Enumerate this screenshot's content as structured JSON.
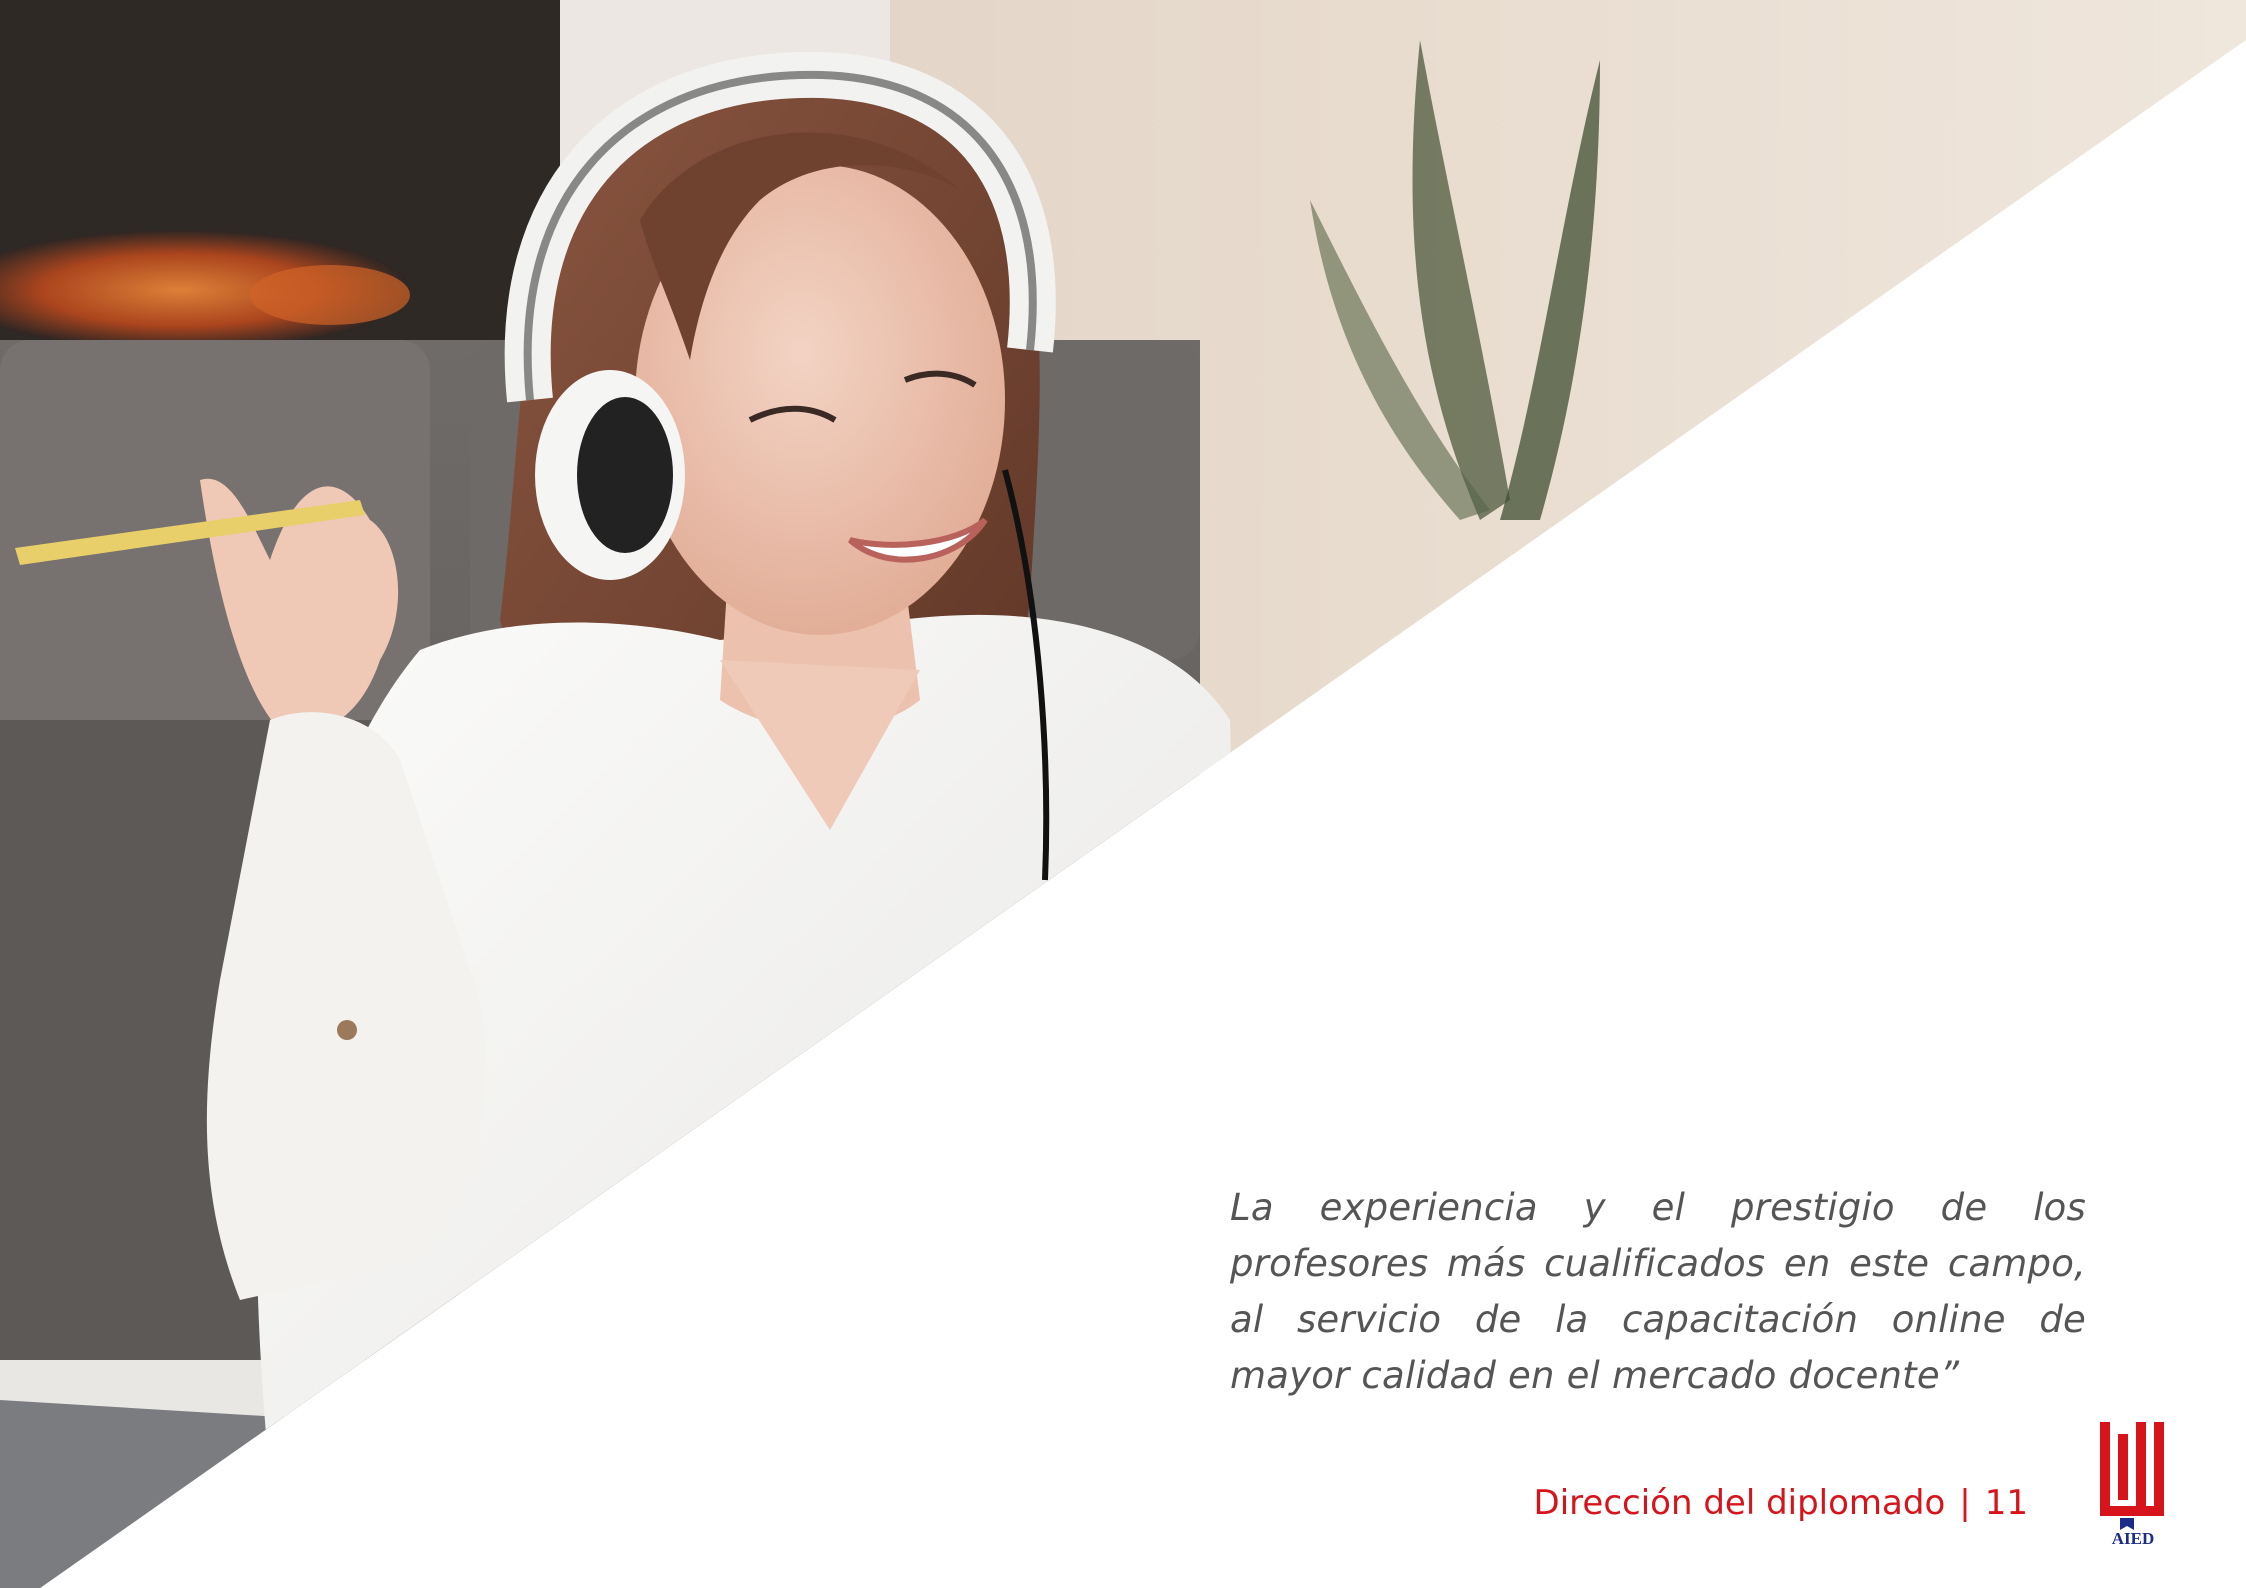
{
  "quote": {
    "text": "La experiencia y el prestigio de los profesores más cualificados en este campo, al servicio de la capacitación online de mayor calidad en el mercado docente”"
  },
  "footer": {
    "section": "Dirección del diplomado",
    "separator": "|",
    "page_number": "11"
  },
  "logo": {
    "text": "AIED"
  },
  "colors": {
    "accent": "#d7141c",
    "quote_text": "#555555",
    "background": "#ffffff"
  }
}
